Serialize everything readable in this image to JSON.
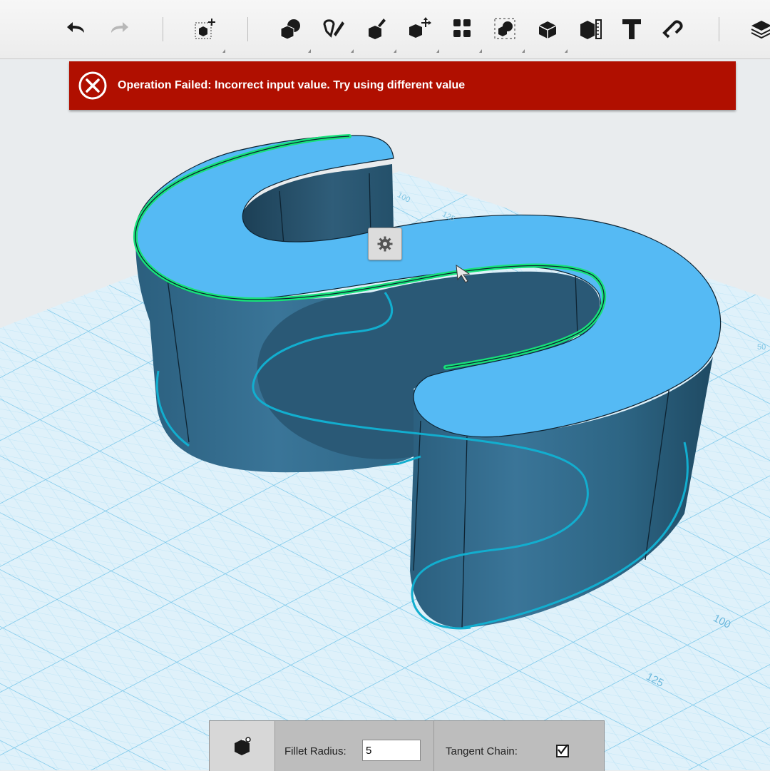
{
  "toolbar": {
    "buttons": [
      {
        "name": "undo-icon"
      },
      {
        "name": "redo-icon"
      },
      {
        "name": "transform-icon"
      },
      {
        "name": "primitives-icon"
      },
      {
        "name": "sketch-icon"
      },
      {
        "name": "construct-icon"
      },
      {
        "name": "modify-icon"
      },
      {
        "name": "pattern-icon"
      },
      {
        "name": "grouping-icon"
      },
      {
        "name": "combine-icon"
      },
      {
        "name": "measure-icon"
      },
      {
        "name": "text-icon"
      },
      {
        "name": "snap-icon"
      },
      {
        "name": "material-icon"
      }
    ]
  },
  "error_banner": {
    "message": "Operation Failed: Incorrect input value. Try using different value",
    "icon": "error-circle-x-icon",
    "color": "#b00f00"
  },
  "viewport": {
    "grid_labels": [
      "100",
      "125",
      "50",
      "125",
      "100"
    ]
  },
  "context_menu": {
    "icon": "gear-icon"
  },
  "fillet_panel": {
    "tool_icon": "fillet-icon",
    "radius_label": "Fillet Radius:",
    "radius_value": "5",
    "tangent_label": "Tangent Chain:",
    "tangent_checked": true
  },
  "colors": {
    "top_face": "#55baf4",
    "side_face": "#2e6585",
    "selected_edge": "#1bf07a",
    "grid_line": "#8fd0ee",
    "error_red": "#b00f00"
  }
}
